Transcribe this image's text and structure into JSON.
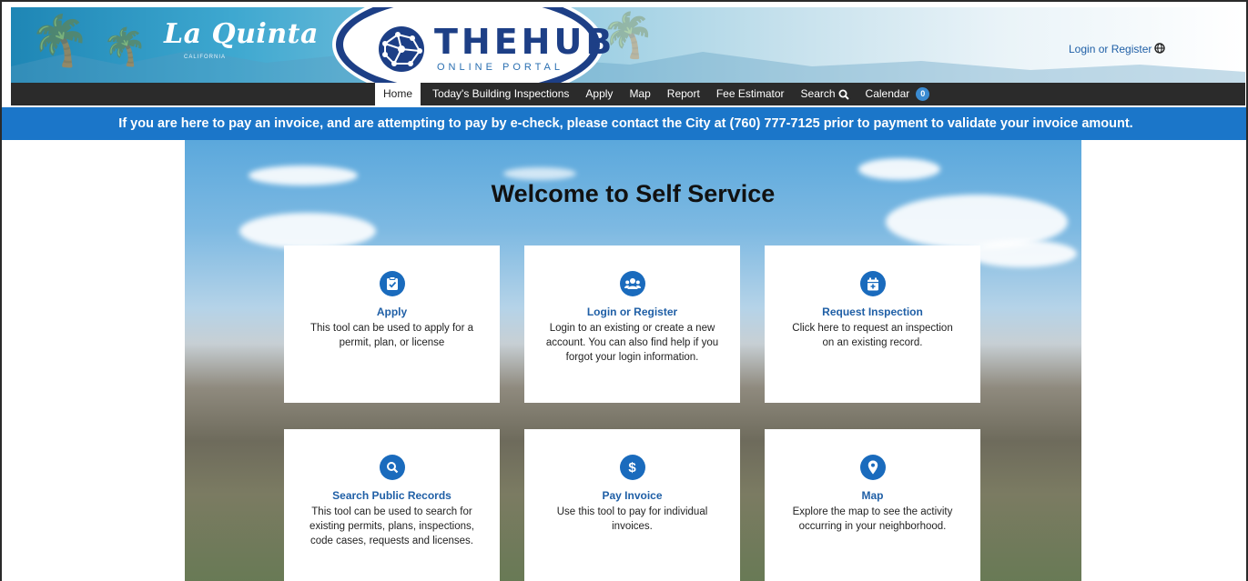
{
  "header": {
    "brand": "La Quinta",
    "brand_sub": "CALIFORNIA",
    "hub_title": "THEHUB",
    "hub_subtitle": "ONLINE PORTAL",
    "login_register": "Login or Register",
    "globe_icon": "globe-icon"
  },
  "nav": {
    "items": [
      {
        "label": "Home",
        "active": true
      },
      {
        "label": "Today's Building Inspections"
      },
      {
        "label": "Apply"
      },
      {
        "label": "Map"
      },
      {
        "label": "Report"
      },
      {
        "label": "Fee Estimator"
      },
      {
        "label": "Search",
        "icon": "search-icon"
      },
      {
        "label": "Calendar",
        "badge": "0"
      }
    ]
  },
  "banner": {
    "text": "If you are here to pay an invoice, and are attempting to pay by e-check, please contact the City at (760) 777-7125 prior to payment to validate your invoice amount."
  },
  "main": {
    "title": "Welcome to Self Service",
    "cards": [
      {
        "title": "Apply",
        "description": "This tool can be used to apply for a permit, plan, or license",
        "icon": "clipboard-check-icon"
      },
      {
        "title": "Login or Register",
        "description": "Login to an existing or create a new account. You can also find help if you forgot your login information.",
        "icon": "users-icon"
      },
      {
        "title": "Request Inspection",
        "description": "Click here to request an inspection on an existing record.",
        "icon": "calendar-plus-icon"
      },
      {
        "title": "Search Public Records",
        "description": "This tool can be used to search for existing permits, plans, inspections, code cases, requests and licenses.",
        "icon": "search-icon"
      },
      {
        "title": "Pay Invoice",
        "description": "Use this tool to pay for individual invoices.",
        "icon": "dollar-icon"
      },
      {
        "title": "Map",
        "description": "Explore the map to see the activity occurring in your neighborhood.",
        "icon": "map-pin-icon"
      }
    ]
  },
  "colors": {
    "accent": "#1a6bbd",
    "banner": "#1b76c9",
    "nav": "#2b2b2b",
    "hub_navy": "#1d3f86"
  }
}
